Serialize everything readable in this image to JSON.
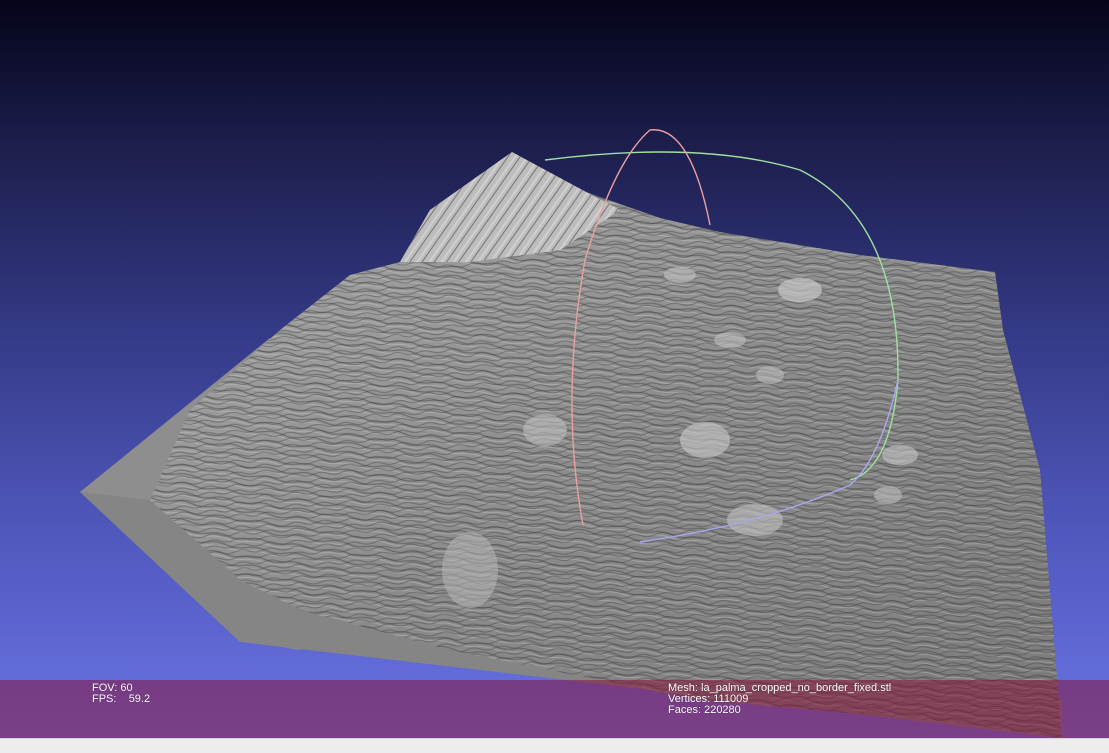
{
  "viewer": {
    "background_top": "#04041a",
    "background_bottom": "#6a74e4",
    "overlay_color": "#87143c"
  },
  "info_left": {
    "fov_label": "FOV:",
    "fov_value": "60",
    "fps_label": "FPS:",
    "fps_value": "59.2"
  },
  "info_right": {
    "mesh_label": "Mesh:",
    "mesh_value": "la_palma_cropped_no_border_fixed.stl",
    "vertices_label": "Vertices:",
    "vertices_value": "111009",
    "faces_label": "Faces:",
    "faces_value": "220280"
  },
  "trackball": {
    "x_axis_color": "#e8a0a0",
    "y_axis_color": "#a0e0a0",
    "z_axis_color": "#a8a8f0"
  }
}
